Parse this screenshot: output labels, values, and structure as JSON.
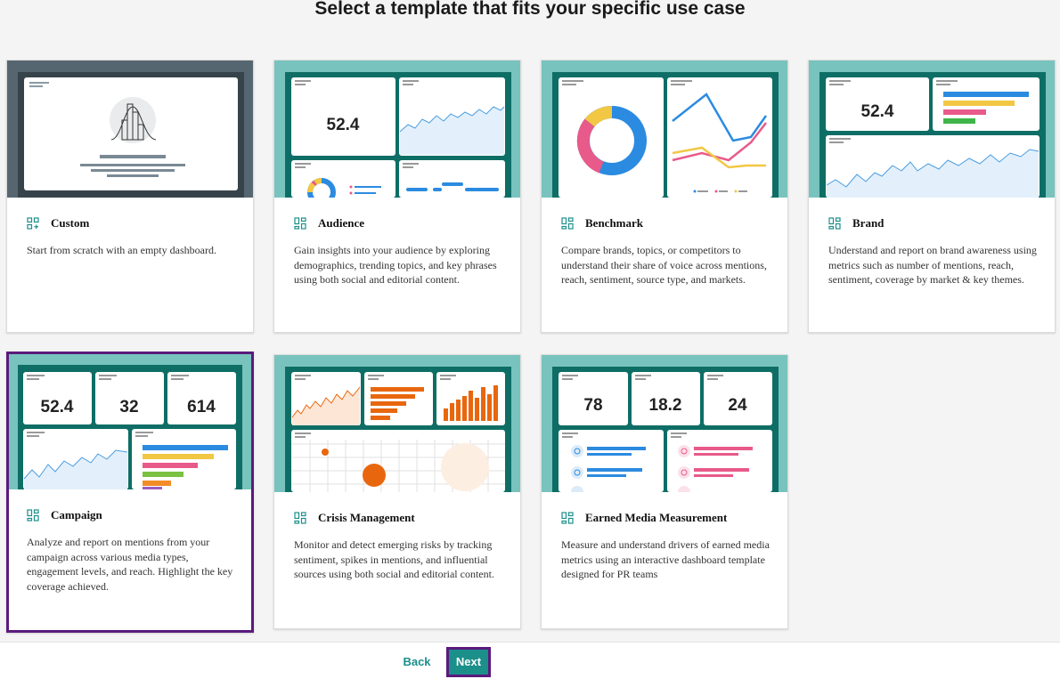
{
  "page": {
    "title": "Select a template that fits your specific use case"
  },
  "colors": {
    "accent": "#1b8f8a",
    "selected_border": "#5b1a7c",
    "thumb_teal": "#78c3bd",
    "thumb_dark_teal": "#0e6e66"
  },
  "templates": [
    {
      "name": "Custom",
      "icon": "add-template-icon",
      "description": "Start from scratch with an empty dashboard.",
      "selected": false
    },
    {
      "name": "Audience",
      "icon": "dashboard-template-icon",
      "description": "Gain insights into your audience by exploring demographics, trending topics, and key phrases using both social and editorial content.",
      "preview_metric": "52.4",
      "selected": false
    },
    {
      "name": "Benchmark",
      "icon": "dashboard-template-icon",
      "description": "Compare brands, topics, or competitors to understand their share of voice across mentions, reach, sentiment, source type, and markets.",
      "selected": false
    },
    {
      "name": "Brand",
      "icon": "dashboard-template-icon",
      "description": "Understand and report on brand awareness using metrics such as number of mentions, reach, sentiment, coverage by market & key themes.",
      "preview_metric": "52.4",
      "selected": false
    },
    {
      "name": "Campaign",
      "icon": "dashboard-template-icon",
      "description": "Analyze and report on mentions from your campaign across various media types, engagement levels, and reach. Highlight the key coverage achieved.",
      "preview_metrics": [
        "52.4",
        "32",
        "614"
      ],
      "selected": true
    },
    {
      "name": "Crisis Management",
      "icon": "dashboard-template-icon",
      "description": "Monitor and detect emerging risks by tracking sentiment, spikes in mentions, and influential sources using both social and editorial content.",
      "selected": false
    },
    {
      "name": "Earned Media Measurement",
      "icon": "dashboard-template-icon",
      "description": "Measure and understand drivers of earned media metrics using an interactive dashboard template designed for PR teams",
      "preview_metrics": [
        "78",
        "18.2",
        "24"
      ],
      "selected": false
    }
  ],
  "footer": {
    "back_label": "Back",
    "next_label": "Next"
  }
}
